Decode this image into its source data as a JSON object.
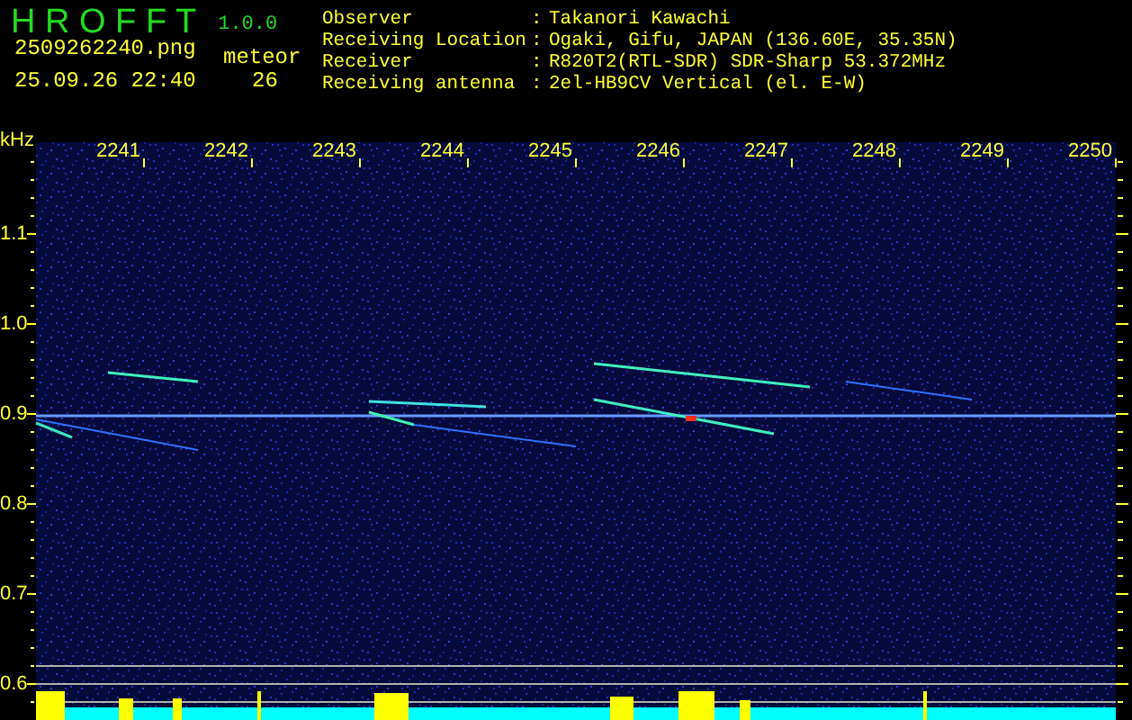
{
  "app": {
    "title": "H R O F F T",
    "version": "1.0.0"
  },
  "file": "2509262240.png",
  "timestamp": "25.09.26 22:40",
  "meteor": {
    "label": "meteor",
    "count": "26"
  },
  "info": [
    {
      "label": "Observer",
      "separator": ":",
      "value": "Takanori Kawachi"
    },
    {
      "label": "Receiving Location",
      "separator": ":",
      "value": "Ogaki, Gifu, JAPAN (136.60E, 35.35N)"
    },
    {
      "label": "Receiver",
      "separator": ":",
      "value": "R820T2(RTL-SDR) SDR-Sharp 53.372MHz"
    },
    {
      "label": "Receiving antenna",
      "separator": ":",
      "value": "2el-HB9CV Vertical (el. E-W)"
    }
  ],
  "axis": {
    "unit": "kHz",
    "x_ticks": [
      "2241",
      "2242",
      "2243",
      "2244",
      "2245",
      "2246",
      "2247",
      "2248",
      "2249",
      "2250"
    ],
    "y_ticks": [
      "1.1",
      "1.0",
      "0.9",
      "0.8",
      "0.7",
      "0.6"
    ]
  }
}
